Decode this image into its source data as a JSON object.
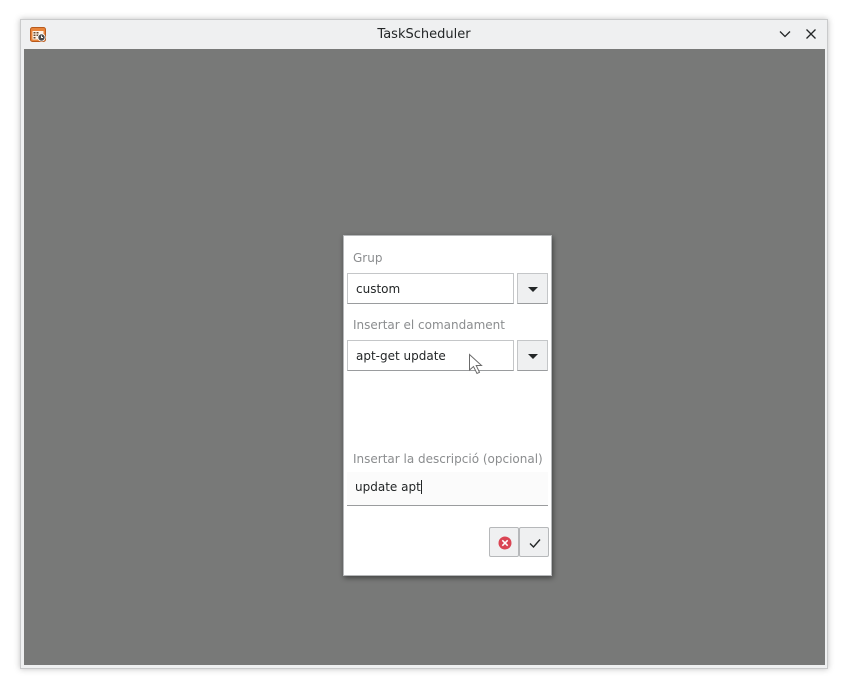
{
  "window": {
    "title": "TaskScheduler",
    "icon": "calendar-clock-icon",
    "controls": [
      "minimize-chevron-icon",
      "close-icon"
    ]
  },
  "dialog": {
    "group": {
      "label": "Grup",
      "value": "custom",
      "dropdown_icon": "caret-down-icon"
    },
    "command": {
      "label": "Insertar el comandament",
      "value": "apt-get update",
      "dropdown_icon": "caret-down-icon"
    },
    "description": {
      "label": "Insertar la descripció (opcional)",
      "value": "update apt"
    },
    "buttons": {
      "cancel_icon": "cancel-icon",
      "accept_icon": "checkmark-icon"
    }
  },
  "colors": {
    "workspace_background": "#787978",
    "window_chrome": "#eff0f1",
    "cancel_red": "#da4453",
    "text": "#232627",
    "label_gray": "#8b8d8f"
  }
}
